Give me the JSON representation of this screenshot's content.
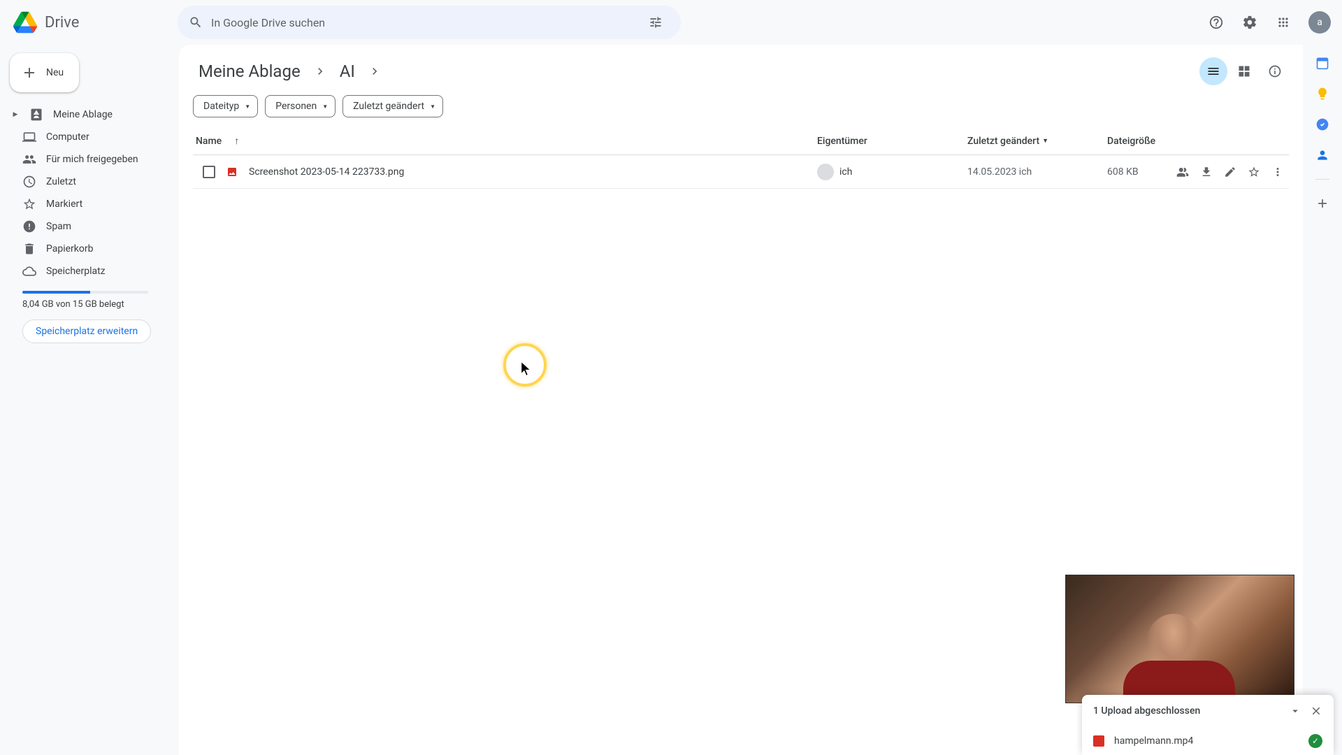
{
  "app": {
    "name": "Drive"
  },
  "search": {
    "placeholder": "In Google Drive suchen"
  },
  "avatar_letter": "a",
  "new_button": "Neu",
  "sidebar": {
    "items": [
      {
        "label": "Meine Ablage"
      },
      {
        "label": "Computer"
      },
      {
        "label": "Für mich freigegeben"
      },
      {
        "label": "Zuletzt"
      },
      {
        "label": "Markiert"
      },
      {
        "label": "Spam"
      },
      {
        "label": "Papierkorb"
      },
      {
        "label": "Speicherplatz"
      }
    ],
    "storage_text": "8,04 GB von 15 GB belegt",
    "storage_pct": 54,
    "upgrade": "Speicherplatz erweitern"
  },
  "breadcrumb": [
    {
      "label": "Meine Ablage"
    },
    {
      "label": "AI"
    }
  ],
  "filters": [
    {
      "label": "Dateityp"
    },
    {
      "label": "Personen"
    },
    {
      "label": "Zuletzt geändert"
    }
  ],
  "columns": {
    "name": "Name",
    "owner": "Eigentümer",
    "modified": "Zuletzt geändert",
    "size": "Dateigröße"
  },
  "rows": [
    {
      "name": "Screenshot 2023-05-14 223733.png",
      "owner": "ich",
      "modified": "14.05.2023 ich",
      "size": "608 KB"
    }
  ],
  "upload": {
    "title": "1 Upload abgeschlossen",
    "file": "hampelmann.mp4"
  }
}
